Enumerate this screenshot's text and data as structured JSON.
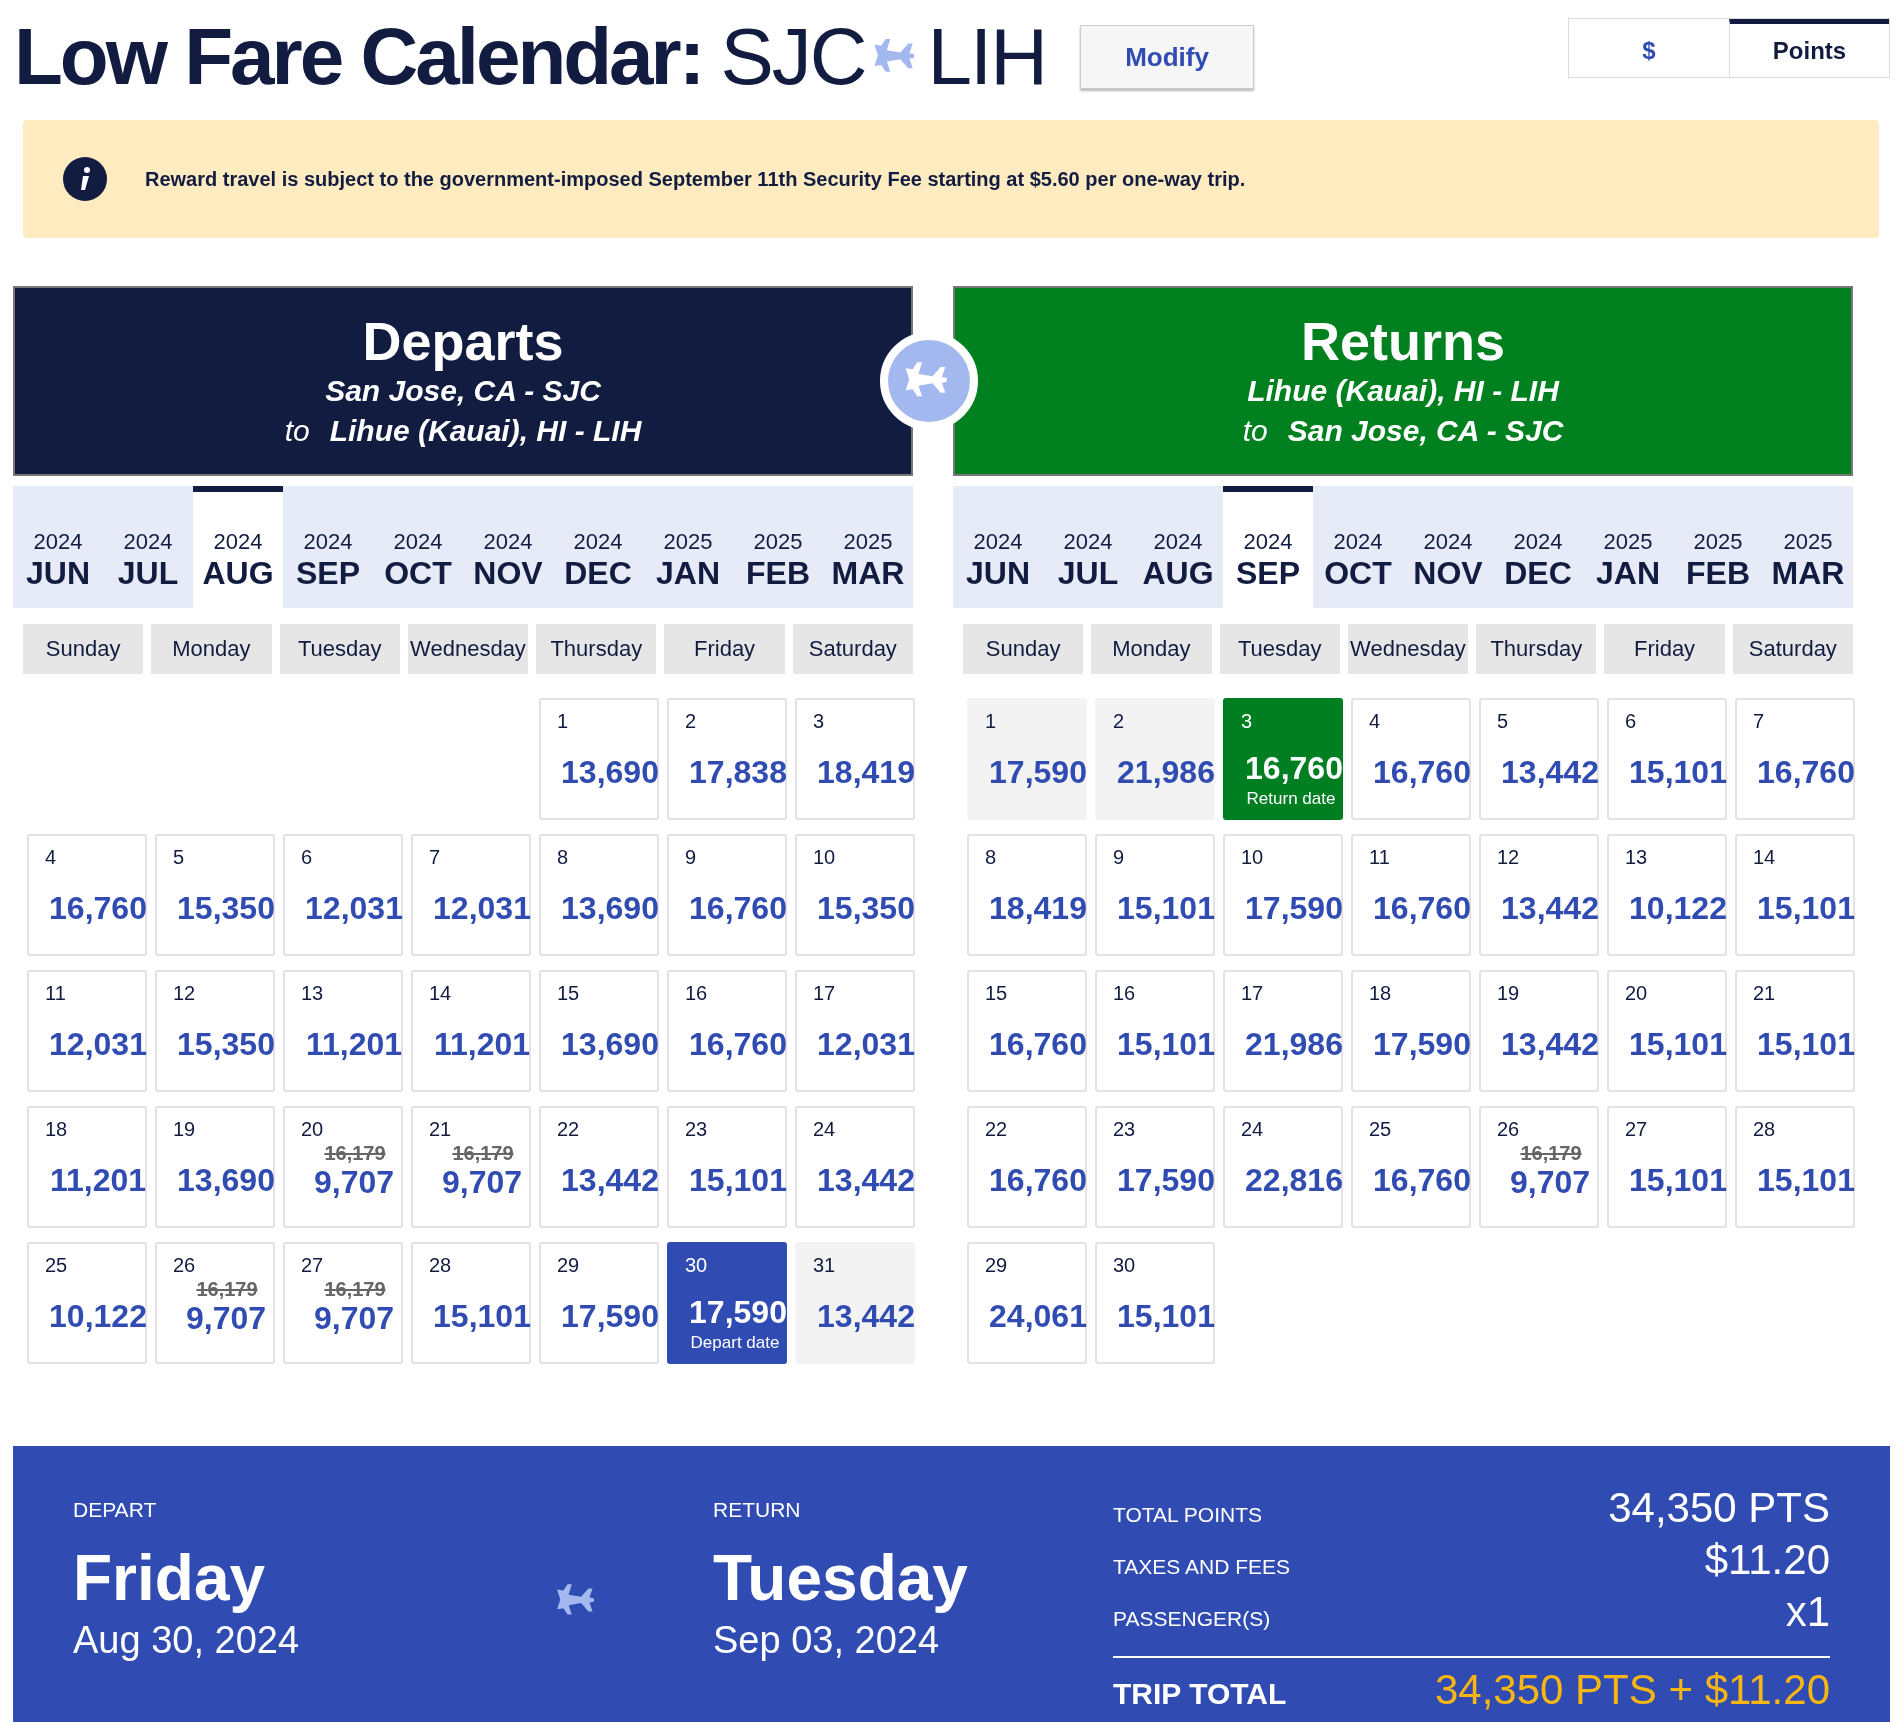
{
  "header": {
    "title": "Low Fare Calendar:",
    "origin": "SJC",
    "destination": "LIH",
    "modify": "Modify"
  },
  "currency_tabs": [
    {
      "label": "$",
      "selected": false
    },
    {
      "label": "Points",
      "selected": true
    }
  ],
  "notice": {
    "text": "Reward travel is subject to the government-imposed September 11th Security Fee starting at $5.60 per one-way trip."
  },
  "calendars": [
    {
      "kind": "depart",
      "title": "Departs",
      "from": "San Jose, CA - SJC",
      "to_word": "to",
      "to": "Lihue (Kauai), HI - LIH",
      "months": [
        {
          "year": "2024",
          "month": "JUN",
          "selected": false
        },
        {
          "year": "2024",
          "month": "JUL",
          "selected": false
        },
        {
          "year": "2024",
          "month": "AUG",
          "selected": true
        },
        {
          "year": "2024",
          "month": "SEP",
          "selected": false
        },
        {
          "year": "2024",
          "month": "OCT",
          "selected": false
        },
        {
          "year": "2024",
          "month": "NOV",
          "selected": false
        },
        {
          "year": "2024",
          "month": "DEC",
          "selected": false
        },
        {
          "year": "2025",
          "month": "JAN",
          "selected": false
        },
        {
          "year": "2025",
          "month": "FEB",
          "selected": false
        },
        {
          "year": "2025",
          "month": "MAR",
          "selected": false
        }
      ],
      "weekdays": [
        "Sunday",
        "Monday",
        "Tuesday",
        "Wednesday",
        "Thursday",
        "Friday",
        "Saturday"
      ],
      "weeks": [
        [
          {
            "kind": "empty"
          },
          {
            "kind": "empty"
          },
          {
            "kind": "empty"
          },
          {
            "kind": "empty"
          },
          {
            "kind": "day",
            "day": "1",
            "points": "13,690",
            "shaded": false,
            "selected": false
          },
          {
            "kind": "day",
            "day": "2",
            "points": "17,838",
            "shaded": false,
            "selected": false
          },
          {
            "kind": "day",
            "day": "3",
            "points": "18,419",
            "shaded": false,
            "selected": false
          }
        ],
        [
          {
            "kind": "day",
            "day": "4",
            "points": "16,760",
            "shaded": false,
            "selected": false
          },
          {
            "kind": "day",
            "day": "5",
            "points": "15,350",
            "shaded": false,
            "selected": false
          },
          {
            "kind": "day",
            "day": "6",
            "points": "12,031",
            "shaded": false,
            "selected": false
          },
          {
            "kind": "day",
            "day": "7",
            "points": "12,031",
            "shaded": false,
            "selected": false
          },
          {
            "kind": "day",
            "day": "8",
            "points": "13,690",
            "shaded": false,
            "selected": false
          },
          {
            "kind": "day",
            "day": "9",
            "points": "16,760",
            "shaded": false,
            "selected": false
          },
          {
            "kind": "day",
            "day": "10",
            "points": "15,350",
            "shaded": false,
            "selected": false
          }
        ],
        [
          {
            "kind": "day",
            "day": "11",
            "points": "12,031",
            "shaded": false,
            "selected": false
          },
          {
            "kind": "day",
            "day": "12",
            "points": "15,350",
            "shaded": false,
            "selected": false
          },
          {
            "kind": "day",
            "day": "13",
            "points": "11,201",
            "shaded": false,
            "selected": false
          },
          {
            "kind": "day",
            "day": "14",
            "points": "11,201",
            "shaded": false,
            "selected": false
          },
          {
            "kind": "day",
            "day": "15",
            "points": "13,690",
            "shaded": false,
            "selected": false
          },
          {
            "kind": "day",
            "day": "16",
            "points": "16,760",
            "shaded": false,
            "selected": false
          },
          {
            "kind": "day",
            "day": "17",
            "points": "12,031",
            "shaded": false,
            "selected": false
          }
        ],
        [
          {
            "kind": "day",
            "day": "18",
            "points": "11,201",
            "shaded": false,
            "selected": false
          },
          {
            "kind": "day",
            "day": "19",
            "points": "13,690",
            "shaded": false,
            "selected": false
          },
          {
            "kind": "day",
            "day": "20",
            "was": "16,179",
            "points": "9,707",
            "shaded": false,
            "selected": false
          },
          {
            "kind": "day",
            "day": "21",
            "was": "16,179",
            "points": "9,707",
            "shaded": false,
            "selected": false
          },
          {
            "kind": "day",
            "day": "22",
            "points": "13,442",
            "shaded": false,
            "selected": false
          },
          {
            "kind": "day",
            "day": "23",
            "points": "15,101",
            "shaded": false,
            "selected": false
          },
          {
            "kind": "day",
            "day": "24",
            "points": "13,442",
            "shaded": false,
            "selected": false
          }
        ],
        [
          {
            "kind": "day",
            "day": "25",
            "points": "10,122",
            "shaded": false,
            "selected": false
          },
          {
            "kind": "day",
            "day": "26",
            "was": "16,179",
            "points": "9,707",
            "shaded": false,
            "selected": false
          },
          {
            "kind": "day",
            "day": "27",
            "was": "16,179",
            "points": "9,707",
            "shaded": false,
            "selected": false
          },
          {
            "kind": "day",
            "day": "28",
            "points": "15,101",
            "shaded": false,
            "selected": false
          },
          {
            "kind": "day",
            "day": "29",
            "points": "17,590",
            "shaded": false,
            "selected": false
          },
          {
            "kind": "day",
            "day": "30",
            "points": "17,590",
            "note": "Depart date",
            "shaded": false,
            "selected": true
          },
          {
            "kind": "day",
            "day": "31",
            "points": "13,442",
            "shaded": true,
            "selected": false
          }
        ]
      ]
    },
    {
      "kind": "return",
      "title": "Returns",
      "from": "Lihue (Kauai), HI - LIH",
      "to_word": "to",
      "to": "San Jose, CA - SJC",
      "months": [
        {
          "year": "2024",
          "month": "JUN",
          "selected": false
        },
        {
          "year": "2024",
          "month": "JUL",
          "selected": false
        },
        {
          "year": "2024",
          "month": "AUG",
          "selected": false
        },
        {
          "year": "2024",
          "month": "SEP",
          "selected": true
        },
        {
          "year": "2024",
          "month": "OCT",
          "selected": false
        },
        {
          "year": "2024",
          "month": "NOV",
          "selected": false
        },
        {
          "year": "2024",
          "month": "DEC",
          "selected": false
        },
        {
          "year": "2025",
          "month": "JAN",
          "selected": false
        },
        {
          "year": "2025",
          "month": "FEB",
          "selected": false
        },
        {
          "year": "2025",
          "month": "MAR",
          "selected": false
        }
      ],
      "weekdays": [
        "Sunday",
        "Monday",
        "Tuesday",
        "Wednesday",
        "Thursday",
        "Friday",
        "Saturday"
      ],
      "weeks": [
        [
          {
            "kind": "day",
            "day": "1",
            "points": "17,590",
            "shaded": true,
            "selected": false
          },
          {
            "kind": "day",
            "day": "2",
            "points": "21,986",
            "shaded": true,
            "selected": false
          },
          {
            "kind": "day",
            "day": "3",
            "points": "16,760",
            "note": "Return date",
            "shaded": false,
            "selected": true
          },
          {
            "kind": "day",
            "day": "4",
            "points": "16,760",
            "shaded": false,
            "selected": false
          },
          {
            "kind": "day",
            "day": "5",
            "points": "13,442",
            "shaded": false,
            "selected": false
          },
          {
            "kind": "day",
            "day": "6",
            "points": "15,101",
            "shaded": false,
            "selected": false
          },
          {
            "kind": "day",
            "day": "7",
            "points": "16,760",
            "shaded": false,
            "selected": false
          }
        ],
        [
          {
            "kind": "day",
            "day": "8",
            "points": "18,419",
            "shaded": false,
            "selected": false
          },
          {
            "kind": "day",
            "day": "9",
            "points": "15,101",
            "shaded": false,
            "selected": false
          },
          {
            "kind": "day",
            "day": "10",
            "points": "17,590",
            "shaded": false,
            "selected": false
          },
          {
            "kind": "day",
            "day": "11",
            "points": "16,760",
            "shaded": false,
            "selected": false
          },
          {
            "kind": "day",
            "day": "12",
            "points": "13,442",
            "shaded": false,
            "selected": false
          },
          {
            "kind": "day",
            "day": "13",
            "points": "10,122",
            "shaded": false,
            "selected": false
          },
          {
            "kind": "day",
            "day": "14",
            "points": "15,101",
            "shaded": false,
            "selected": false
          }
        ],
        [
          {
            "kind": "day",
            "day": "15",
            "points": "16,760",
            "shaded": false,
            "selected": false
          },
          {
            "kind": "day",
            "day": "16",
            "points": "15,101",
            "shaded": false,
            "selected": false
          },
          {
            "kind": "day",
            "day": "17",
            "points": "21,986",
            "shaded": false,
            "selected": false
          },
          {
            "kind": "day",
            "day": "18",
            "points": "17,590",
            "shaded": false,
            "selected": false
          },
          {
            "kind": "day",
            "day": "19",
            "points": "13,442",
            "shaded": false,
            "selected": false
          },
          {
            "kind": "day",
            "day": "20",
            "points": "15,101",
            "shaded": false,
            "selected": false
          },
          {
            "kind": "day",
            "day": "21",
            "points": "15,101",
            "shaded": false,
            "selected": false
          }
        ],
        [
          {
            "kind": "day",
            "day": "22",
            "points": "16,760",
            "shaded": false,
            "selected": false
          },
          {
            "kind": "day",
            "day": "23",
            "points": "17,590",
            "shaded": false,
            "selected": false
          },
          {
            "kind": "day",
            "day": "24",
            "points": "22,816",
            "shaded": false,
            "selected": false
          },
          {
            "kind": "day",
            "day": "25",
            "points": "16,760",
            "shaded": false,
            "selected": false
          },
          {
            "kind": "day",
            "day": "26",
            "was": "16,179",
            "points": "9,707",
            "shaded": false,
            "selected": false
          },
          {
            "kind": "day",
            "day": "27",
            "points": "15,101",
            "shaded": false,
            "selected": false
          },
          {
            "kind": "day",
            "day": "28",
            "points": "15,101",
            "shaded": false,
            "selected": false
          }
        ],
        [
          {
            "kind": "day",
            "day": "29",
            "points": "24,061",
            "shaded": false,
            "selected": false
          },
          {
            "kind": "day",
            "day": "30",
            "points": "15,101",
            "shaded": false,
            "selected": false
          }
        ]
      ]
    }
  ],
  "summary": {
    "depart_label": "DEPART",
    "depart_day": "Friday",
    "depart_date": "Aug 30, 2024",
    "return_label": "RETURN",
    "return_day": "Tuesday",
    "return_date": "Sep 03, 2024",
    "lines": [
      {
        "label": "TOTAL POINTS",
        "value": "34,350 PTS"
      },
      {
        "label": "TAXES AND FEES",
        "value": "$11.20"
      },
      {
        "label": "PASSENGER(S)",
        "value": "x1"
      }
    ],
    "total_label": "TRIP TOTAL",
    "total_value": "34,350 PTS + $11.20"
  }
}
